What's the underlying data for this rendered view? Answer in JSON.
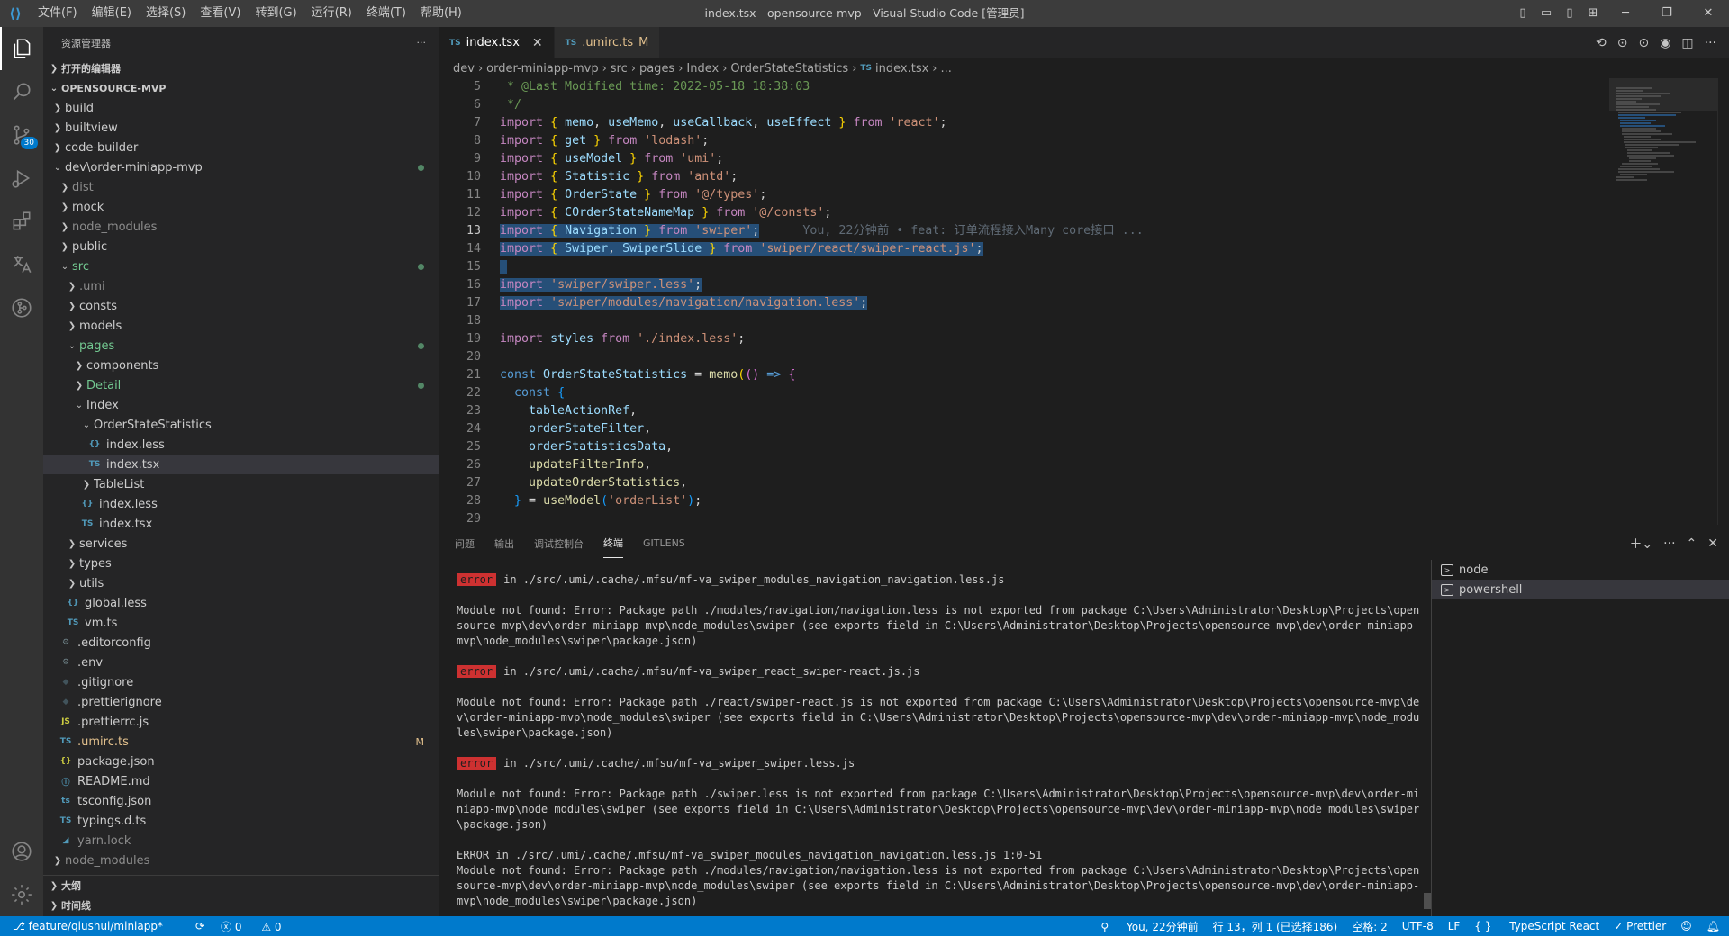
{
  "window": {
    "title": "index.tsx - opensource-mvp - Visual Studio Code [管理员]",
    "menus": [
      "文件(F)",
      "编辑(E)",
      "选择(S)",
      "查看(V)",
      "转到(G)",
      "运行(R)",
      "终端(T)",
      "帮助(H)"
    ]
  },
  "activity": {
    "scm_badge": "30"
  },
  "sidebar": {
    "header": "资源管理器",
    "more": "···",
    "open_editors": "打开的编辑器",
    "workspace": "OPENSOURCE-MVP",
    "outline": "大纲",
    "timeline": "时间线",
    "tree": [
      {
        "label": "build",
        "depth": 0,
        "kind": "folder",
        "open": false
      },
      {
        "label": "builtview",
        "depth": 0,
        "kind": "folder",
        "open": false
      },
      {
        "label": "code-builder",
        "depth": 0,
        "kind": "folder",
        "open": false
      },
      {
        "label": "dev\\order-miniapp-mvp",
        "depth": 0,
        "kind": "folder",
        "open": true,
        "status": "dot"
      },
      {
        "label": "dist",
        "depth": 1,
        "kind": "folder",
        "open": false,
        "dim": true
      },
      {
        "label": "mock",
        "depth": 1,
        "kind": "folder",
        "open": false
      },
      {
        "label": "node_modules",
        "depth": 1,
        "kind": "folder",
        "open": false,
        "dim": true
      },
      {
        "label": "public",
        "depth": 1,
        "kind": "folder",
        "open": false
      },
      {
        "label": "src",
        "depth": 1,
        "kind": "folder",
        "open": true,
        "status": "dot",
        "color": "green"
      },
      {
        "label": ".umi",
        "depth": 2,
        "kind": "folder",
        "open": false,
        "dim": true
      },
      {
        "label": "consts",
        "depth": 2,
        "kind": "folder",
        "open": false
      },
      {
        "label": "models",
        "depth": 2,
        "kind": "folder",
        "open": false
      },
      {
        "label": "pages",
        "depth": 2,
        "kind": "folder",
        "open": true,
        "status": "dot",
        "color": "green"
      },
      {
        "label": "components",
        "depth": 3,
        "kind": "folder",
        "open": false
      },
      {
        "label": "Detail",
        "depth": 3,
        "kind": "folder",
        "open": false,
        "status": "dot",
        "color": "green"
      },
      {
        "label": "Index",
        "depth": 3,
        "kind": "folder",
        "open": true
      },
      {
        "label": "OrderStateStatistics",
        "depth": 4,
        "kind": "folder",
        "open": true
      },
      {
        "label": "index.less",
        "depth": 5,
        "kind": "less"
      },
      {
        "label": "index.tsx",
        "depth": 5,
        "kind": "ts",
        "selected": true
      },
      {
        "label": "TableList",
        "depth": 4,
        "kind": "folder",
        "open": false
      },
      {
        "label": "index.less",
        "depth": 4,
        "kind": "less"
      },
      {
        "label": "index.tsx",
        "depth": 4,
        "kind": "ts"
      },
      {
        "label": "services",
        "depth": 2,
        "kind": "folder",
        "open": false
      },
      {
        "label": "types",
        "depth": 2,
        "kind": "folder",
        "open": false
      },
      {
        "label": "utils",
        "depth": 2,
        "kind": "folder",
        "open": false
      },
      {
        "label": "global.less",
        "depth": 2,
        "kind": "less"
      },
      {
        "label": "vm.ts",
        "depth": 2,
        "kind": "ts"
      },
      {
        "label": ".editorconfig",
        "depth": 1,
        "kind": "gear"
      },
      {
        "label": ".env",
        "depth": 1,
        "kind": "gear"
      },
      {
        "label": ".gitignore",
        "depth": 1,
        "kind": "git"
      },
      {
        "label": ".prettierignore",
        "depth": 1,
        "kind": "prettier"
      },
      {
        "label": ".prettierrc.js",
        "depth": 1,
        "kind": "js"
      },
      {
        "label": ".umirc.ts",
        "depth": 1,
        "kind": "ts",
        "status": "M",
        "color": "modified"
      },
      {
        "label": "package.json",
        "depth": 1,
        "kind": "json"
      },
      {
        "label": "README.md",
        "depth": 1,
        "kind": "info"
      },
      {
        "label": "tsconfig.json",
        "depth": 1,
        "kind": "tsconfig"
      },
      {
        "label": "typings.d.ts",
        "depth": 1,
        "kind": "ts"
      },
      {
        "label": "yarn.lock",
        "depth": 1,
        "kind": "yarn",
        "dim": true
      },
      {
        "label": "node_modules",
        "depth": 0,
        "kind": "folder",
        "open": false,
        "dim": true
      }
    ]
  },
  "tabs": [
    {
      "label": "index.tsx",
      "active": true,
      "close": "✕"
    },
    {
      "label": ".umirc.ts",
      "active": false,
      "status": "M"
    }
  ],
  "breadcrumb": [
    "dev",
    "order-miniapp-mvp",
    "src",
    "pages",
    "Index",
    "OrderStateStatistics",
    "index.tsx",
    "..."
  ],
  "code": {
    "current_line": 13,
    "blame": "You, 22分钟前 • feat: 订单流程接入Many core接口 ..."
  },
  "panel": {
    "tabs": [
      "问题",
      "输出",
      "调试控制台",
      "终端",
      "GITLENS"
    ],
    "active_tab": "终端",
    "terminals": [
      "node",
      "powershell"
    ],
    "active_terminal": "powershell",
    "output": [
      {
        "badge": "error",
        "text": "in ./src/.umi/.cache/.mfsu/mf-va_swiper_modules_navigation_navigation.less.js"
      },
      {
        "text": "Module not found: Error: Package path ./modules/navigation/navigation.less is not exported from package C:\\Users\\Administrator\\Desktop\\Projects\\opensource-mvp\\dev\\order-miniapp-mvp\\node_modules\\swiper (see exports field in C:\\Users\\Administrator\\Desktop\\Projects\\opensource-mvp\\dev\\order-miniapp-mvp\\node_modules\\swiper\\package.json)"
      },
      {
        "badge": "error",
        "text": "in ./src/.umi/.cache/.mfsu/mf-va_swiper_react_swiper-react.js.js"
      },
      {
        "text": "Module not found: Error: Package path ./react/swiper-react.js is not exported from package C:\\Users\\Administrator\\Desktop\\Projects\\opensource-mvp\\dev\\order-miniapp-mvp\\node_modules\\swiper (see exports field in C:\\Users\\Administrator\\Desktop\\Projects\\opensource-mvp\\dev\\order-miniapp-mvp\\node_modules\\swiper\\package.json)"
      },
      {
        "badge": "error",
        "text": "in ./src/.umi/.cache/.mfsu/mf-va_swiper_swiper.less.js"
      },
      {
        "text": "Module not found: Error: Package path ./swiper.less is not exported from package C:\\Users\\Administrator\\Desktop\\Projects\\opensource-mvp\\dev\\order-miniapp-mvp\\node_modules\\swiper (see exports field in C:\\Users\\Administrator\\Desktop\\Projects\\opensource-mvp\\dev\\order-miniapp-mvp\\node_modules\\swiper\\package.json)"
      },
      {
        "text": "ERROR in ./src/.umi/.cache/.mfsu/mf-va_swiper_modules_navigation_navigation.less.js 1:0-51\nModule not found: Error: Package path ./modules/navigation/navigation.less is not exported from package C:\\Users\\Administrator\\Desktop\\Projects\\opensource-mvp\\dev\\order-miniapp-mvp\\node_modules\\swiper (see exports field in C:\\Users\\Administrator\\Desktop\\Projects\\opensource-mvp\\dev\\order-miniapp-mvp\\node_modules\\swiper\\package.json)"
      }
    ]
  },
  "statusbar": {
    "branch": "feature/qiushui/miniapp*",
    "sync": "⟳",
    "errors": "0",
    "warnings": "0",
    "blame": "You, 22分钟前",
    "position": "行 13，列 1 (已选择186)",
    "spaces": "空格: 2",
    "encoding": "UTF-8",
    "eol": "LF",
    "language": "TypeScript React",
    "prettier": "✓ Prettier"
  },
  "colors": {
    "statusbar": "#007acc",
    "selection": "#264f78",
    "keyword": "#569cd6",
    "string": "#ce9178",
    "comment": "#6a9955"
  }
}
